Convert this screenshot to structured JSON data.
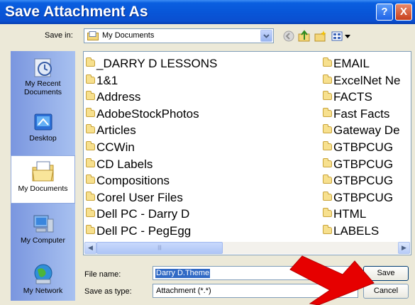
{
  "dialog": {
    "title": "Save Attachment As",
    "help_glyph": "?",
    "close_glyph": "X"
  },
  "save_in": {
    "label": "Save in:",
    "value": "My Documents"
  },
  "places": [
    {
      "line1": "My Recent",
      "line2": "Documents",
      "icon": "recent-documents-icon"
    },
    {
      "line1": "Desktop",
      "line2": "",
      "icon": "desktop-icon"
    },
    {
      "line1": "My Documents",
      "line2": "",
      "icon": "my-documents-icon"
    },
    {
      "line1": "My Computer",
      "line2": "",
      "icon": "my-computer-icon"
    },
    {
      "line1": "My Network",
      "line2": "",
      "icon": "my-network-icon"
    }
  ],
  "folders_col1": [
    "_DARRY D LESSONS",
    "1&1",
    "Address",
    "AdobeStockPhotos",
    "Articles",
    "CCWin",
    "CD Labels",
    "Compositions",
    "Corel User Files",
    "Dell PC - Darry D",
    "Dell PC - PegEgg"
  ],
  "folders_col2": [
    "EMAIL",
    "ExcelNet Ne",
    "FACTS",
    "Fast Facts",
    "Gateway De",
    "GTBPCUG",
    "GTBPCUG",
    "GTBPCUG",
    "GTBPCUG",
    "HTML",
    "LABELS"
  ],
  "file_name": {
    "label": "File name:",
    "value": "Darry D.Theme"
  },
  "save_as_type": {
    "label": "Save as type:",
    "value": "Attachment (*.*)"
  },
  "buttons": {
    "save": "Save",
    "cancel": "Cancel"
  },
  "colors": {
    "titlebar": "#0856d8",
    "arrow": "#e60000",
    "dialog_bg": "#ece9d8"
  }
}
